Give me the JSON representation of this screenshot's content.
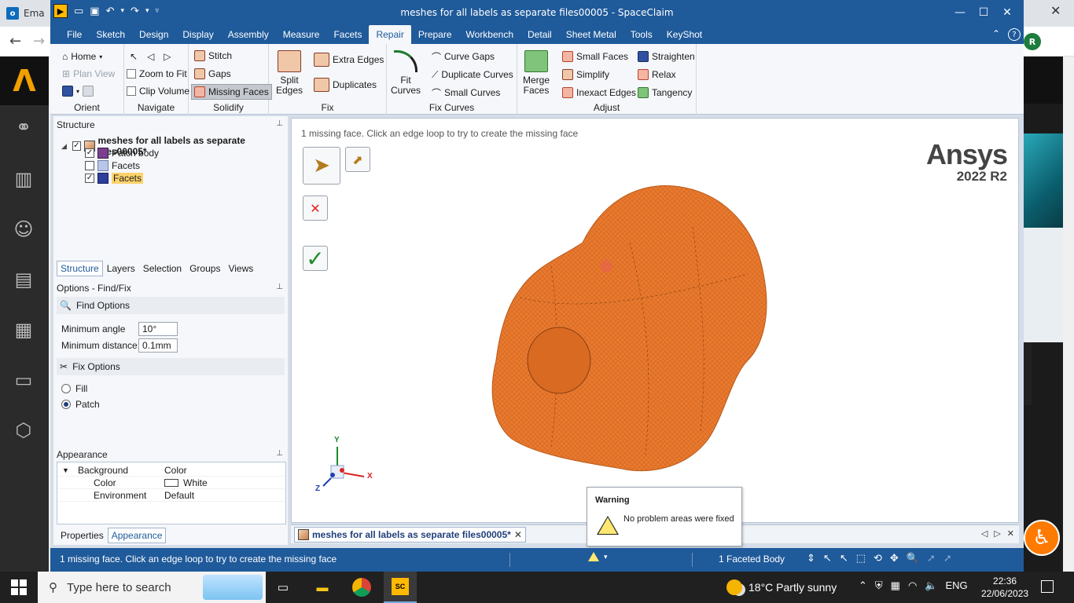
{
  "background": {
    "tab_label": "Ema",
    "avatar_initial": "R",
    "page_help": "?"
  },
  "window": {
    "title": "meshes for all labels as separate files00005 - SpaceClaim",
    "logo_glyph": "▶",
    "minimize": "—",
    "maximize": "☐",
    "close": "✕"
  },
  "menu": {
    "items": [
      "File",
      "Sketch",
      "Design",
      "Display",
      "Assembly",
      "Measure",
      "Facets",
      "Repair",
      "Prepare",
      "Workbench",
      "Detail",
      "Sheet Metal",
      "Tools",
      "KeyShot"
    ],
    "active": "Repair",
    "collapse": "⌃",
    "help": "?"
  },
  "ribbon": {
    "orient": {
      "label": "Orient",
      "home": "Home",
      "plan_view": "Plan View"
    },
    "navigate": {
      "label": "Navigate",
      "zoom_to_fit": "Zoom to Fit",
      "clip_volume": "Clip Volume"
    },
    "solidify": {
      "label": "Solidify",
      "stitch": "Stitch",
      "gaps": "Gaps",
      "missing_faces": "Missing Faces"
    },
    "fix": {
      "label": "Fix",
      "split_edges_1": "Split",
      "split_edges_2": "Edges",
      "extra_edges": "Extra Edges",
      "duplicates": "Duplicates"
    },
    "fix_curves": {
      "label": "Fix Curves",
      "fit_curves_1": "Fit",
      "fit_curves_2": "Curves",
      "curve_gaps": "Curve Gaps",
      "duplicate_curves": "Duplicate Curves",
      "small_curves": "Small Curves"
    },
    "adjust": {
      "label": "Adjust",
      "merge_faces_1": "Merge",
      "merge_faces_2": "Faces",
      "small_faces": "Small Faces",
      "simplify": "Simplify",
      "inexact_edges": "Inexact Edges",
      "straighten": "Straighten",
      "relax": "Relax",
      "tangency": "Tangency"
    }
  },
  "structure": {
    "title": "Structure",
    "root": "meshes for all labels as separate files00005*",
    "children": [
      {
        "label": "Patch body",
        "checked": true
      },
      {
        "label": "Facets",
        "checked": false
      },
      {
        "label": "Facets",
        "checked": true,
        "highlighted": true
      }
    ],
    "tabs": [
      "Structure",
      "Layers",
      "Selection",
      "Groups",
      "Views"
    ]
  },
  "options": {
    "title": "Options - Find/Fix",
    "find_options": "Find Options",
    "min_angle_label": "Minimum angle",
    "min_angle_value": "10°",
    "min_distance_label": "Minimum distance:",
    "min_distance_value": "0.1mm",
    "fix_options": "Fix Options",
    "fill": "Fill",
    "patch": "Patch",
    "selected": "Patch"
  },
  "appearance": {
    "title": "Appearance",
    "rows": [
      {
        "key": "Background",
        "value": "Color"
      },
      {
        "key": "Color",
        "value": "White"
      },
      {
        "key": "Environment",
        "value": "Default"
      }
    ],
    "bottom_tabs": [
      "Properties",
      "Appearance"
    ]
  },
  "viewport": {
    "hint": "1 missing face. Click an edge loop to try to create the missing face",
    "brand_name": "Ansys",
    "brand_version": "2022 R2",
    "axis_x": "X",
    "axis_y": "Y",
    "axis_z": "Z",
    "mesh_color": "#e8792e"
  },
  "doc_tab": {
    "label": "meshes for all labels as separate files00005*",
    "close": "✕"
  },
  "warning": {
    "title": "Warning",
    "message": "No problem areas were fixed"
  },
  "status": {
    "message": "1 missing face. Click an edge loop to try to create the missing face",
    "selection": "1 Faceted Body"
  },
  "taskbar": {
    "search_placeholder": "Type here to search",
    "sc_label": "SC",
    "weather": "18°C  Partly sunny",
    "language": "ENG",
    "time": "22:36",
    "date": "22/06/2023"
  }
}
